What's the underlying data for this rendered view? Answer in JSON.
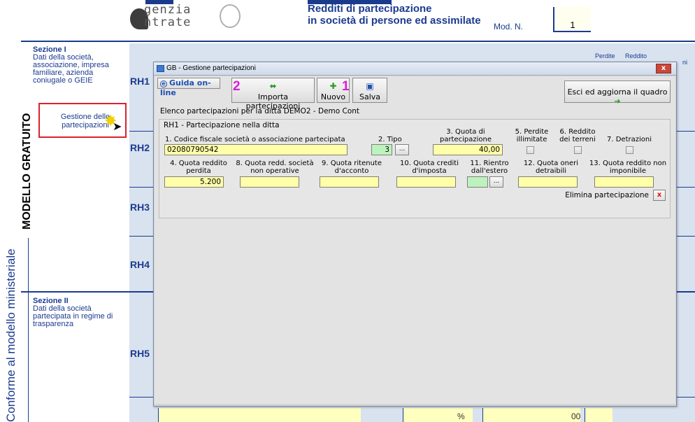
{
  "header": {
    "logo_line1": "genzia",
    "logo_line2": "ntrate",
    "form_title_line1": "Redditi di partecipazione",
    "form_title_line2": "in società di persone ed assimilate",
    "mod_label": "Mod. N.",
    "mod_number": "1"
  },
  "sidebar": {
    "sezione1_title": "Sezione I",
    "sezione1_desc": "Dati della società, associazione, impresa familiare, azienda coniugale o GEIE",
    "gestione_label": "Gestione delle partecipazioni",
    "sezione2_title": "Sezione II",
    "sezione2_desc": "Dati della società partecipata in regime di trasparenza",
    "vertical_main": "MODELLO GRATUITO",
    "vertical_conforme": "Conforme al modello ministeriale"
  },
  "rows": {
    "rh1": "RH1",
    "rh2": "RH2",
    "rh3": "RH3",
    "rh4": "RH4",
    "rh5": "RH5"
  },
  "bg_headers": {
    "perdite": "Perdite",
    "reddito": "Reddito",
    "ni": "ni"
  },
  "bottom": {
    "percent": "%",
    "infinity": "00"
  },
  "dialog": {
    "title": "GB - Gestione partecipazioni",
    "close": "x",
    "guida": "Guida on-line",
    "importa": "Importa partecipazioni",
    "nuovo": "Nuovo",
    "salva": "Salva",
    "esci": "Esci ed aggiorna il quadro",
    "tag2": "2",
    "tag1": "1",
    "elenco": "Elenco partecipazioni per la ditta DEMO2 -  Demo Cont",
    "panel_header": "RH1 - Partecipazione nella ditta",
    "labels": {
      "f1": "1. Codice fiscale società o associazione partecipata",
      "f2": "2. Tipo",
      "f3": "3. Quota di partecipazione",
      "f5": "5. Perdite illimitate",
      "f6": "6. Reddito dei terreni",
      "f7": "7. Detrazioni",
      "f4": "4. Quota reddito perdita",
      "f8": "8. Quota redd. società non operative",
      "f9": "9. Quota ritenute d'acconto",
      "f10": "10. Quota crediti d'imposta",
      "f11": "11. Rientro dall'estero",
      "f12": "12. Quota oneri detraibili",
      "f13": "13. Quota reddito non imponibile"
    },
    "values": {
      "codice_fiscale": "02080790542",
      "tipo": "3",
      "quota_partecipazione": "40,00",
      "quota_reddito_perdita": "5.200",
      "quota_non_operative": "",
      "quota_ritenute": "",
      "quota_crediti": "",
      "rientro_estero": "",
      "quota_oneri": "",
      "quota_non_imponibile": ""
    },
    "ellipsis": "...",
    "elimina": "Elimina partecipazione",
    "elimina_x": "x"
  }
}
